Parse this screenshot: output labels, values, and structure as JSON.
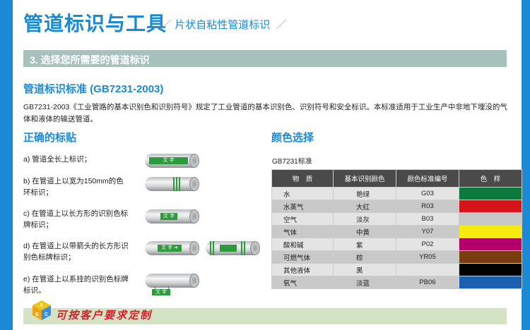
{
  "header": {
    "title": "管道标识与工具",
    "subtitle": "片状自粘性管道标识"
  },
  "section": {
    "label": "3. 选择您所需要的管道标识"
  },
  "standard": {
    "title": "管道标识标准 (GB7231-2003)",
    "description": "GB7231-2003《工业管路的基本识别色和识别符号》规定了工业管道的基本识别色、识别符号和安全标识。本标准适用于工业生产中非地下埋没的气体和液体的输送管道。"
  },
  "labeling": {
    "title": "正确的标贴",
    "items": [
      {
        "text": "a) 管道全长上标识；",
        "tag": "文 字"
      },
      {
        "text": "b) 在管道上以宽为150mm的色环标识；"
      },
      {
        "text": "c) 在管道上以长方形的识别色标牌标识；",
        "tag": "文 字"
      },
      {
        "text": "d) 在管道上以带箭头的长方形识别色标牌标识；",
        "tag": "文 字"
      },
      {
        "text": "e) 在管道上以系挂的识别色标牌标识。",
        "tag": "文 字"
      }
    ]
  },
  "colors": {
    "title": "颜色选择",
    "standard_label": "GB7231标准",
    "headers": [
      "物　质",
      "基本识别颜色",
      "颜色标准编号",
      "色　样"
    ],
    "rows": [
      {
        "substance": "水",
        "color": "艳绿",
        "code": "G03",
        "swatch": "#0b7a3c"
      },
      {
        "substance": "水蒸气",
        "color": "大红",
        "code": "R03",
        "swatch": "#d5151b"
      },
      {
        "substance": "空气",
        "color": "淡灰",
        "code": "B03",
        "swatch": "#c7c7c7"
      },
      {
        "substance": "气体",
        "color": "中黄",
        "code": "Y07",
        "swatch": "#f6ea0e"
      },
      {
        "substance": "酸和碱",
        "color": "紫",
        "code": "P02",
        "swatch": "#b3006b"
      },
      {
        "substance": "可燃气体",
        "color": "棕",
        "code": "YR05",
        "swatch": "#7a3d10"
      },
      {
        "substance": "其他液体",
        "color": "黑",
        "code": "",
        "swatch": "#000000"
      },
      {
        "substance": "氧气",
        "color": "淡蓝",
        "code": "PB06",
        "swatch": "#1a5fb0"
      }
    ]
  },
  "custom": {
    "label": "可按客户要求定制"
  },
  "theme": {
    "accent": "#1a8ad4",
    "section_bg": "#a7c2bb",
    "tag_green": "#2e9a3e",
    "custom_red": "#d0212a"
  }
}
